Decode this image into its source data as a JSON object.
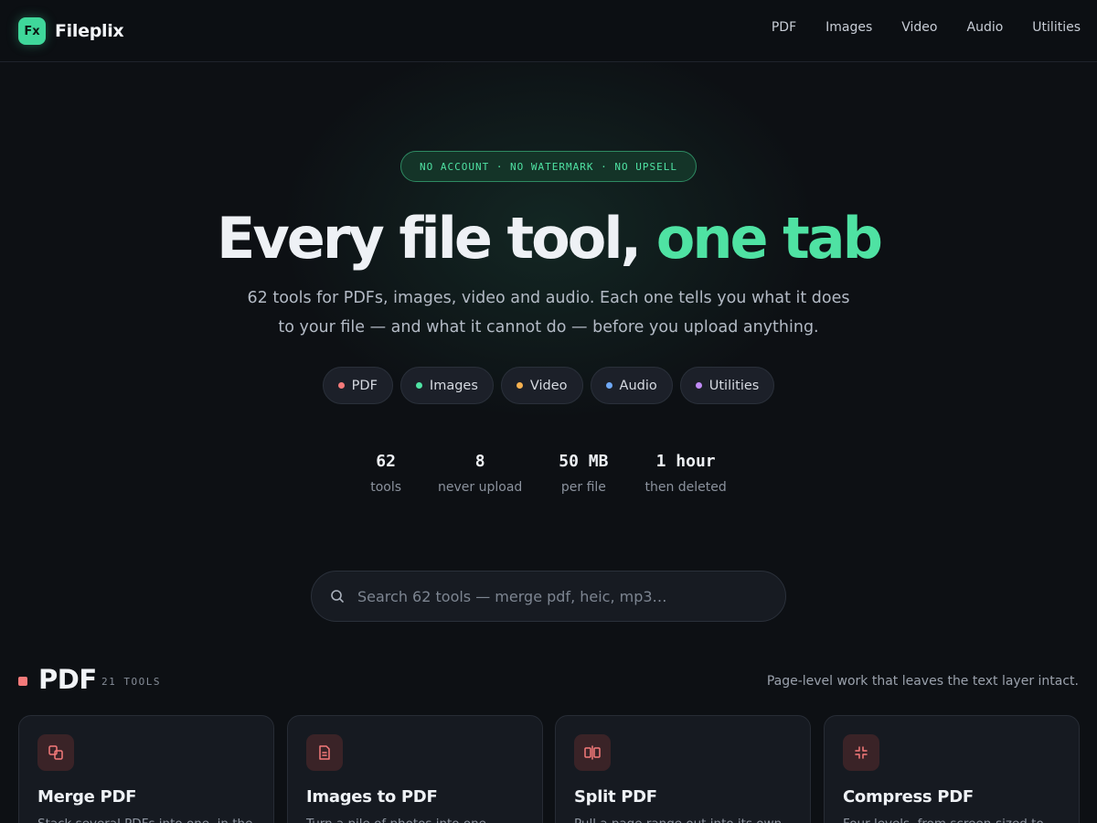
{
  "brand": {
    "logo_mark": "Fx",
    "name": "Fileplix"
  },
  "nav": {
    "items": [
      "PDF",
      "Images",
      "Video",
      "Audio",
      "Utilities"
    ]
  },
  "hero": {
    "badge": "NO ACCOUNT · NO WATERMARK · NO UPSELL",
    "headline_main": "Every file tool,",
    "headline_accent": "one tab",
    "subtitle": "62 tools for PDFs, images, video and audio. Each one tells you what it does to your file — and what it cannot do — before you upload anything."
  },
  "categories": [
    {
      "label": "PDF",
      "color": "#f47a7a"
    },
    {
      "label": "Images",
      "color": "#4fe2a3"
    },
    {
      "label": "Video",
      "color": "#f5b04f"
    },
    {
      "label": "Audio",
      "color": "#6fa8f5"
    },
    {
      "label": "Utilities",
      "color": "#c08af5"
    }
  ],
  "stats": [
    {
      "value": "62",
      "label": "tools"
    },
    {
      "value": "8",
      "label": "never upload"
    },
    {
      "value": "50 MB",
      "label": "per file"
    },
    {
      "value": "1 hour",
      "label": "then deleted"
    }
  ],
  "search": {
    "placeholder": "Search 62 tools — merge pdf, heic, mp3…",
    "icon": "search-icon"
  },
  "section": {
    "title": "PDF",
    "count": "21 TOOLS",
    "description": "Page-level work that leaves the text layer intact.",
    "accent": "#f47a7a"
  },
  "cards": [
    {
      "title": "Merge PDF",
      "desc": "Stack several PDFs into one, in the order you choose.",
      "icon": "merge-icon"
    },
    {
      "title": "Images to PDF",
      "desc": "Turn a pile of photos into one document.",
      "icon": "document-icon"
    },
    {
      "title": "Split PDF",
      "desc": "Pull a page range out into its own file.",
      "icon": "split-icon"
    },
    {
      "title": "Compress PDF",
      "desc": "Four levels, from screen-sized to print.",
      "icon": "compress-icon"
    }
  ]
}
